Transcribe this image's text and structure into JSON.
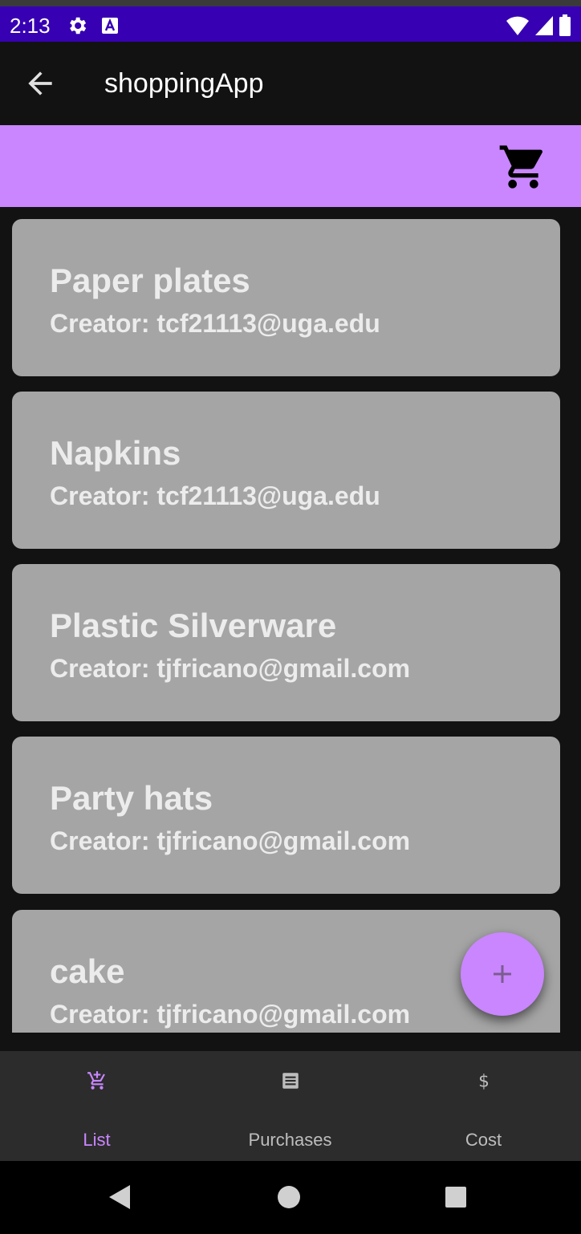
{
  "status_bar": {
    "time": "2:13",
    "color": "#3700b3"
  },
  "app_bar": {
    "title": "shoppingApp",
    "back_icon": "arrow-back-icon"
  },
  "toolbar": {
    "cart_icon": "shopping-cart-icon",
    "color": "#c986ff"
  },
  "items": [
    {
      "name": "Paper plates",
      "creator": "Creator: tcf21113@uga.edu"
    },
    {
      "name": "Napkins",
      "creator": "Creator: tcf21113@uga.edu"
    },
    {
      "name": "Plastic Silverware",
      "creator": "Creator: tjfricano@gmail.com"
    },
    {
      "name": "Party hats",
      "creator": "Creator: tjfricano@gmail.com"
    },
    {
      "name": "cake",
      "creator": "Creator: tjfricano@gmail.com"
    }
  ],
  "fab": {
    "icon": "plus-icon"
  },
  "bottom_nav": {
    "items": [
      {
        "label": "List",
        "icon": "add-shopping-cart-icon",
        "active": true
      },
      {
        "label": "Purchases",
        "icon": "receipt-icon",
        "active": false
      },
      {
        "label": "Cost",
        "icon": "dollar-icon",
        "active": false
      }
    ],
    "active_color": "#c986ff"
  }
}
